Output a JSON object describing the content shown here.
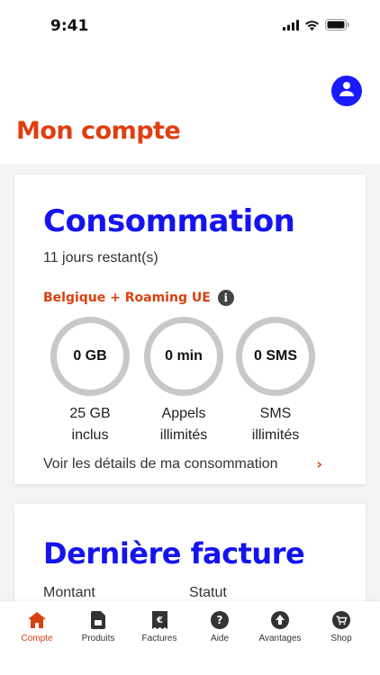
{
  "status_bar": {
    "time": "9:41"
  },
  "header": {
    "title": "Mon compte"
  },
  "consumption": {
    "title": "Consommation",
    "days_left": "11 jours restant(s)",
    "region": "Belgique + Roaming UE",
    "gauges": [
      {
        "value": "0 GB",
        "caption_line1": "25 GB",
        "caption_line2": "inclus"
      },
      {
        "value": "0 min",
        "caption_line1": "Appels",
        "caption_line2": "illimités"
      },
      {
        "value": "0 SMS",
        "caption_line1": "SMS",
        "caption_line2": "illimités"
      }
    ],
    "details_link": "Voir les détails de ma consommation"
  },
  "invoice": {
    "title": "Dernière facture",
    "amount_label": "Montant",
    "status_label": "Statut"
  },
  "tabs": [
    {
      "label": "Compte",
      "icon": "home-icon"
    },
    {
      "label": "Produits",
      "icon": "sim-icon"
    },
    {
      "label": "Factures",
      "icon": "invoice-icon"
    },
    {
      "label": "Aide",
      "icon": "help-icon"
    },
    {
      "label": "Avantages",
      "icon": "arrow-up-icon"
    },
    {
      "label": "Shop",
      "icon": "cart-icon"
    }
  ],
  "colors": {
    "accent": "#d9400f",
    "brand_blue": "#1414f0",
    "ring_gray": "#c8c8c8"
  }
}
